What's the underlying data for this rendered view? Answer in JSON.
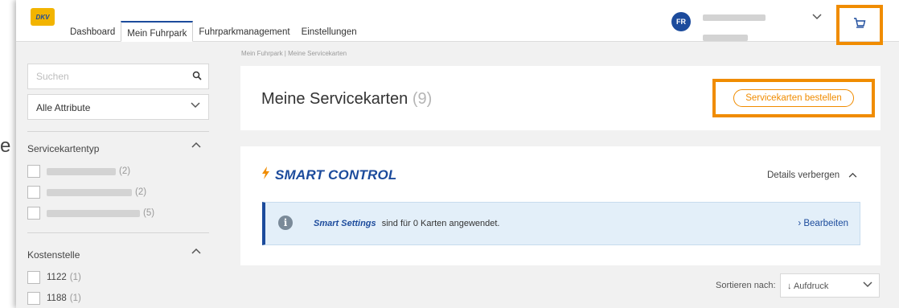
{
  "page_fragment_glyph": "e",
  "header": {
    "logo_text": "DKV",
    "nav": [
      "Dashboard",
      "Mein Fuhrpark",
      "Fuhrparkmanagement",
      "Einstellungen"
    ],
    "active_tab": "Mein Fuhrpark",
    "avatar_initials": "FR",
    "icons": {
      "chevron": "chevron-down-icon",
      "cart": "cart-icon"
    }
  },
  "sidebar": {
    "search": {
      "placeholder": "Suchen",
      "value": ""
    },
    "attribute_select": "Alle Attribute",
    "sections": [
      {
        "title": "Servicekartentyp",
        "items": [
          {
            "label": "",
            "count": "(2)"
          },
          {
            "label": "",
            "count": "(2)"
          },
          {
            "label": "",
            "count": "(5)"
          }
        ]
      },
      {
        "title": "Kostenstelle",
        "items": [
          {
            "label": "1122",
            "count": "(1)"
          },
          {
            "label": "1188",
            "count": "(1)"
          }
        ]
      }
    ]
  },
  "main": {
    "breadcrumb": "Mein Fuhrpark | Meine Servicekarten",
    "title": "Meine Servicekarten",
    "title_count": "(9)",
    "order_button": "Servicekarten bestellen",
    "smart_control": {
      "title": "SMART CONTROL",
      "details_toggle": "Details verbergen",
      "info": {
        "emphasis": "Smart Settings",
        "text": "sind für 0 Karten angewendet.",
        "edit_link": "› Bearbeiten"
      }
    },
    "sort": {
      "label": "Sortieren nach:",
      "value": "↓ Aufdruck"
    }
  },
  "colors": {
    "brand_blue": "#1c4b9c",
    "accent_orange": "#f08c00",
    "logo_yellow": "#f2b400"
  }
}
